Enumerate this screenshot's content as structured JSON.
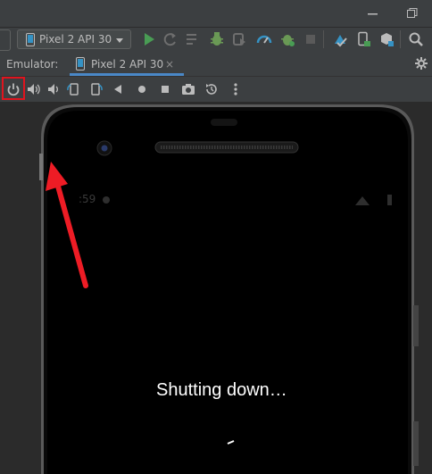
{
  "toolbar": {
    "device_selector": "Pixel 2 API 30"
  },
  "emulator_tab": {
    "label": "Emulator:",
    "tab_title": "Pixel 2 API 30",
    "close_glyph": "×"
  },
  "emulator_toolbar": {
    "items": [
      "power-icon",
      "volume-up-icon",
      "volume-down-icon",
      "rotate-left-icon",
      "rotate-right-icon",
      "back-icon",
      "home-icon",
      "overview-icon",
      "screenshot-icon",
      "snapshot-icon",
      "more-icon"
    ]
  },
  "device_screen": {
    "status_time": ":59",
    "message": "Shutting down…"
  },
  "colors": {
    "highlight": "#e0141e",
    "run": "#499c54",
    "debug": "#6a9955",
    "accent_blue": "#3592c4",
    "arrow": "#ee1c25"
  }
}
